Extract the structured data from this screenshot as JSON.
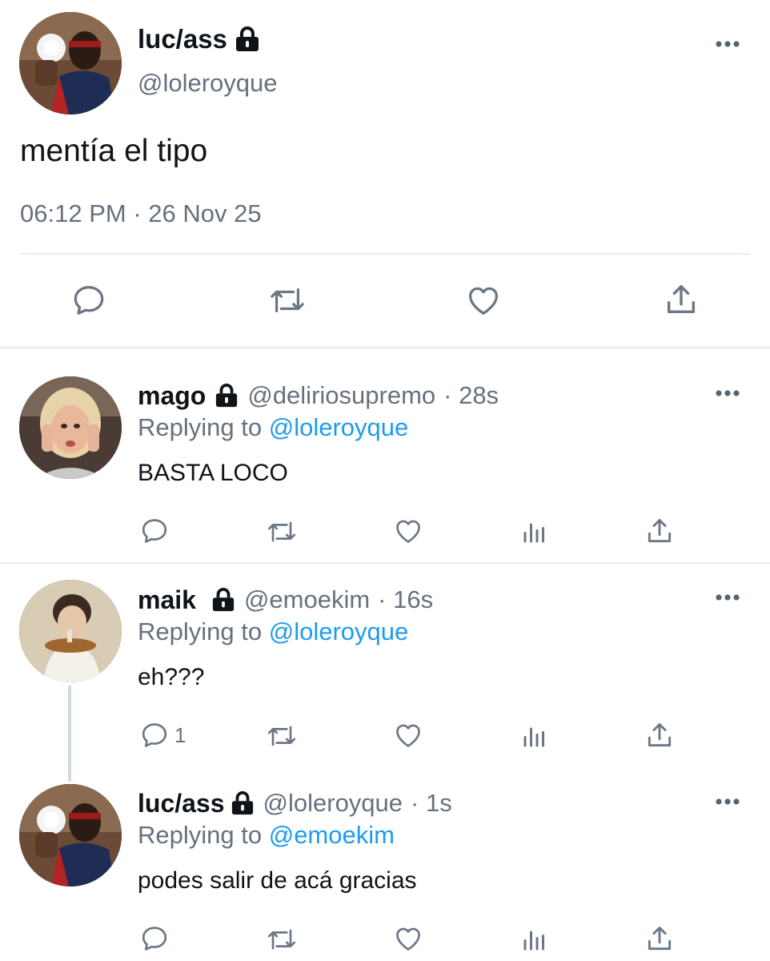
{
  "main_tweet": {
    "name": "luc/ass",
    "handle": "@loleroyque",
    "text": "mentía el tipo",
    "timestamp": "06:12 PM · 26 Nov 25",
    "locked": true
  },
  "replies": [
    {
      "name": "mago",
      "handle": "@deliriosupremo",
      "time": "· 28s",
      "replying_prefix": "Replying to",
      "replying_to": "@loleroyque",
      "text": "BASTA LOCO",
      "reply_count": ""
    },
    {
      "name": "maik",
      "handle": "@emoekim",
      "time": "· 16s",
      "replying_prefix": "Replying to",
      "replying_to": "@loleroyque",
      "text": "eh???",
      "reply_count": "1"
    },
    {
      "name": "luc/ass",
      "handle": "@loleroyque",
      "time": "· 1s",
      "replying_prefix": "Replying to",
      "replying_to": "@emoekim",
      "text": "podes salir de acá gracias",
      "reply_count": ""
    }
  ],
  "icons": {
    "reply": "reply-icon",
    "retweet": "retweet-icon",
    "like": "heart-icon",
    "views": "views-icon",
    "share": "share-icon",
    "more": "more-icon",
    "lock": "lock-icon"
  },
  "colors": {
    "text": "#0f1419",
    "secondary": "#66717d",
    "accent": "#1d9bf0",
    "divider": "#e6ecf0"
  }
}
